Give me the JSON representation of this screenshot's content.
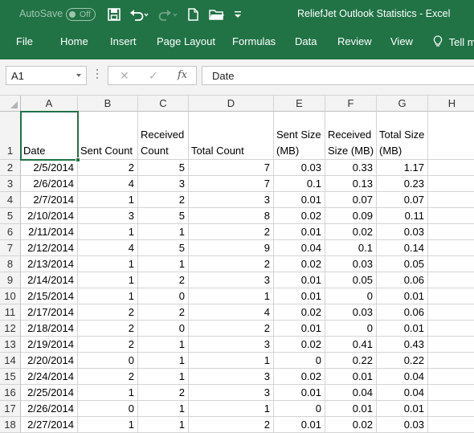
{
  "titlebar": {
    "autosave_label": "AutoSave",
    "autosave_state": "Off",
    "title": "ReliefJet Outlook Statistics  -  Excel",
    "icons": [
      "save-icon",
      "undo-icon",
      "redo-icon",
      "new-file-icon",
      "open-folder-icon",
      "customize-qat-icon"
    ]
  },
  "ribbon": {
    "tabs": [
      "File",
      "Home",
      "Insert",
      "Page Layout",
      "Formulas",
      "Data",
      "Review",
      "View",
      "Tell m"
    ]
  },
  "formula_bar": {
    "name_box": "A1",
    "formula": "Date",
    "icons": [
      "cancel-icon",
      "enter-icon",
      "insert-function-icon"
    ]
  },
  "sheet": {
    "columns": [
      "A",
      "B",
      "C",
      "D",
      "E",
      "F",
      "G",
      "H"
    ],
    "headers": [
      [
        "Date"
      ],
      [
        "Sent Count"
      ],
      [
        "Received",
        "Count"
      ],
      [
        "Total Count"
      ],
      [
        "Sent Size",
        "(MB)"
      ],
      [
        "Received",
        "Size (MB)"
      ],
      [
        "Total Size",
        "(MB)"
      ]
    ],
    "rows": [
      [
        "2/5/2014",
        "2",
        "5",
        "7",
        "0.03",
        "0.33",
        "1.17"
      ],
      [
        "2/6/2014",
        "4",
        "3",
        "7",
        "0.1",
        "0.13",
        "0.23"
      ],
      [
        "2/7/2014",
        "1",
        "2",
        "3",
        "0.01",
        "0.07",
        "0.07"
      ],
      [
        "2/10/2014",
        "3",
        "5",
        "8",
        "0.02",
        "0.09",
        "0.11"
      ],
      [
        "2/11/2014",
        "1",
        "1",
        "2",
        "0.01",
        "0.02",
        "0.03"
      ],
      [
        "2/12/2014",
        "4",
        "5",
        "9",
        "0.04",
        "0.1",
        "0.14"
      ],
      [
        "2/13/2014",
        "1",
        "1",
        "2",
        "0.02",
        "0.03",
        "0.05"
      ],
      [
        "2/14/2014",
        "1",
        "2",
        "3",
        "0.01",
        "0.05",
        "0.06"
      ],
      [
        "2/15/2014",
        "1",
        "0",
        "1",
        "0.01",
        "0",
        "0.01"
      ],
      [
        "2/17/2014",
        "2",
        "2",
        "4",
        "0.02",
        "0.03",
        "0.06"
      ],
      [
        "2/18/2014",
        "2",
        "0",
        "2",
        "0.01",
        "0",
        "0.01"
      ],
      [
        "2/19/2014",
        "2",
        "1",
        "3",
        "0.02",
        "0.41",
        "0.43"
      ],
      [
        "2/20/2014",
        "0",
        "1",
        "1",
        "0",
        "0.22",
        "0.22"
      ],
      [
        "2/24/2014",
        "2",
        "1",
        "3",
        "0.02",
        "0.01",
        "0.04"
      ],
      [
        "2/25/2014",
        "1",
        "2",
        "3",
        "0.01",
        "0.04",
        "0.04"
      ],
      [
        "2/26/2014",
        "0",
        "1",
        "1",
        "0",
        "0.01",
        "0.01"
      ],
      [
        "2/27/2014",
        "1",
        "1",
        "2",
        "0.01",
        "0.02",
        "0.03"
      ]
    ]
  },
  "colors": {
    "accent": "#217346",
    "header_bg": "#f3f3f3",
    "gridline": "#d4d4d4"
  }
}
